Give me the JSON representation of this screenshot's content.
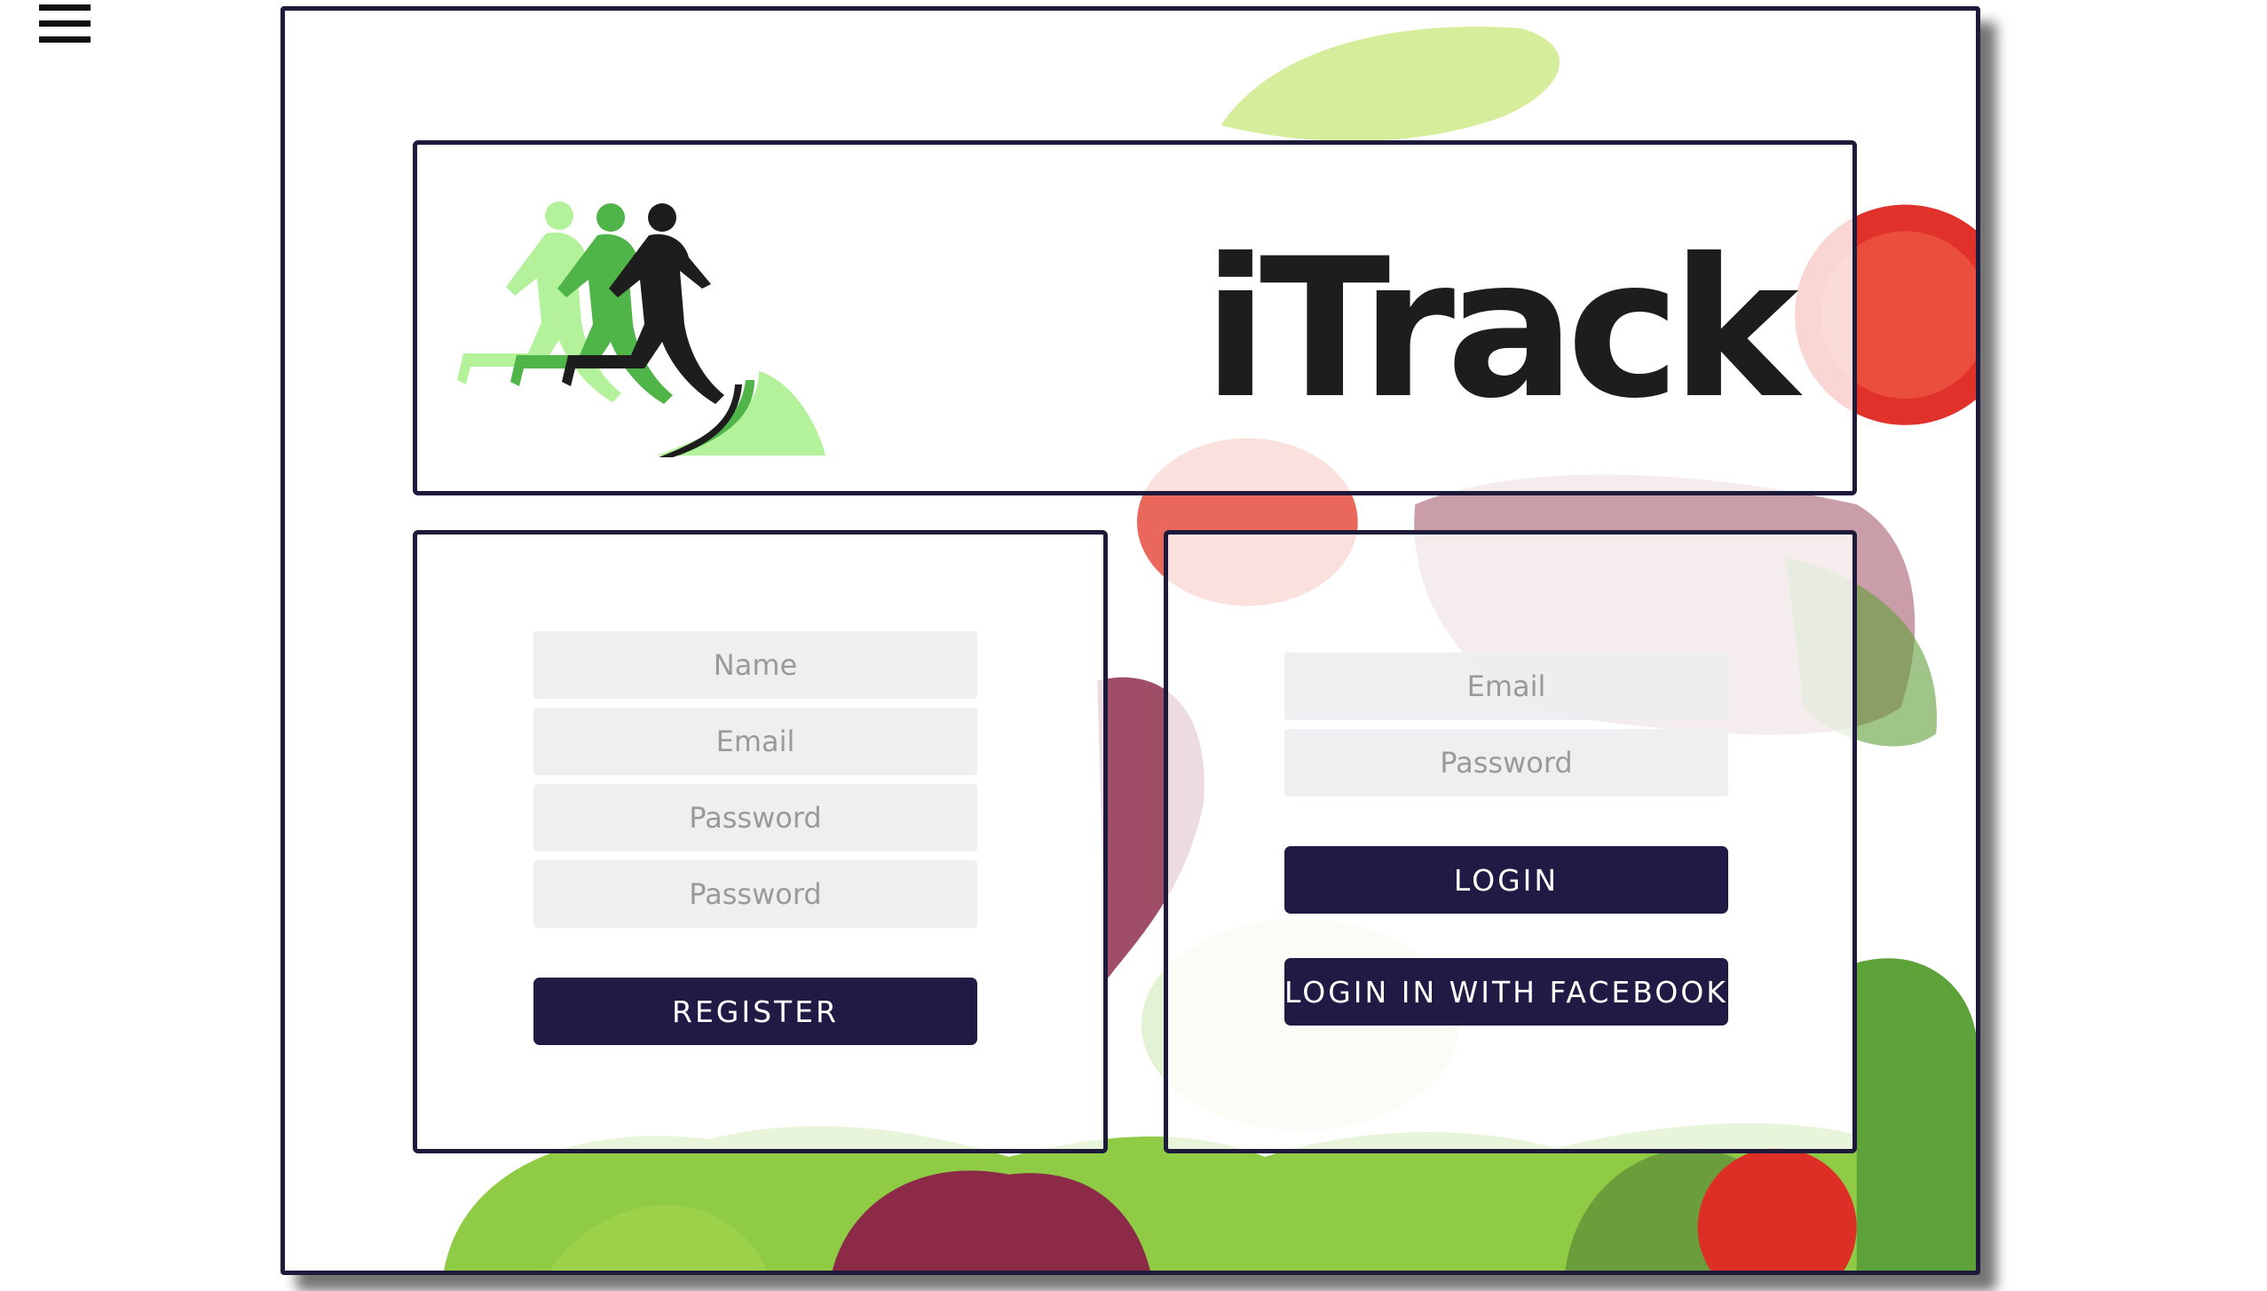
{
  "nav": {
    "menu_icon": "hamburger-menu-icon"
  },
  "header": {
    "logo_icon": "running-figures-logo-icon",
    "brand": "iTrack"
  },
  "register": {
    "name_placeholder": "Name",
    "email_placeholder": "Email",
    "password_placeholder": "Password",
    "confirm_password_placeholder": "Password",
    "button_label": "REGISTER"
  },
  "login": {
    "email_placeholder": "Email",
    "password_placeholder": "Password",
    "button_label": "LOGIN",
    "facebook_button_label": "LOGIN IN WITH FACEBOOK"
  },
  "colors": {
    "border": "#1e1a3c",
    "button": "#201a45",
    "input_bg": "#ebeef0",
    "logo_light": "#b3f29a",
    "logo_mid": "#4fb548",
    "logo_dark": "#1d1d1d"
  }
}
